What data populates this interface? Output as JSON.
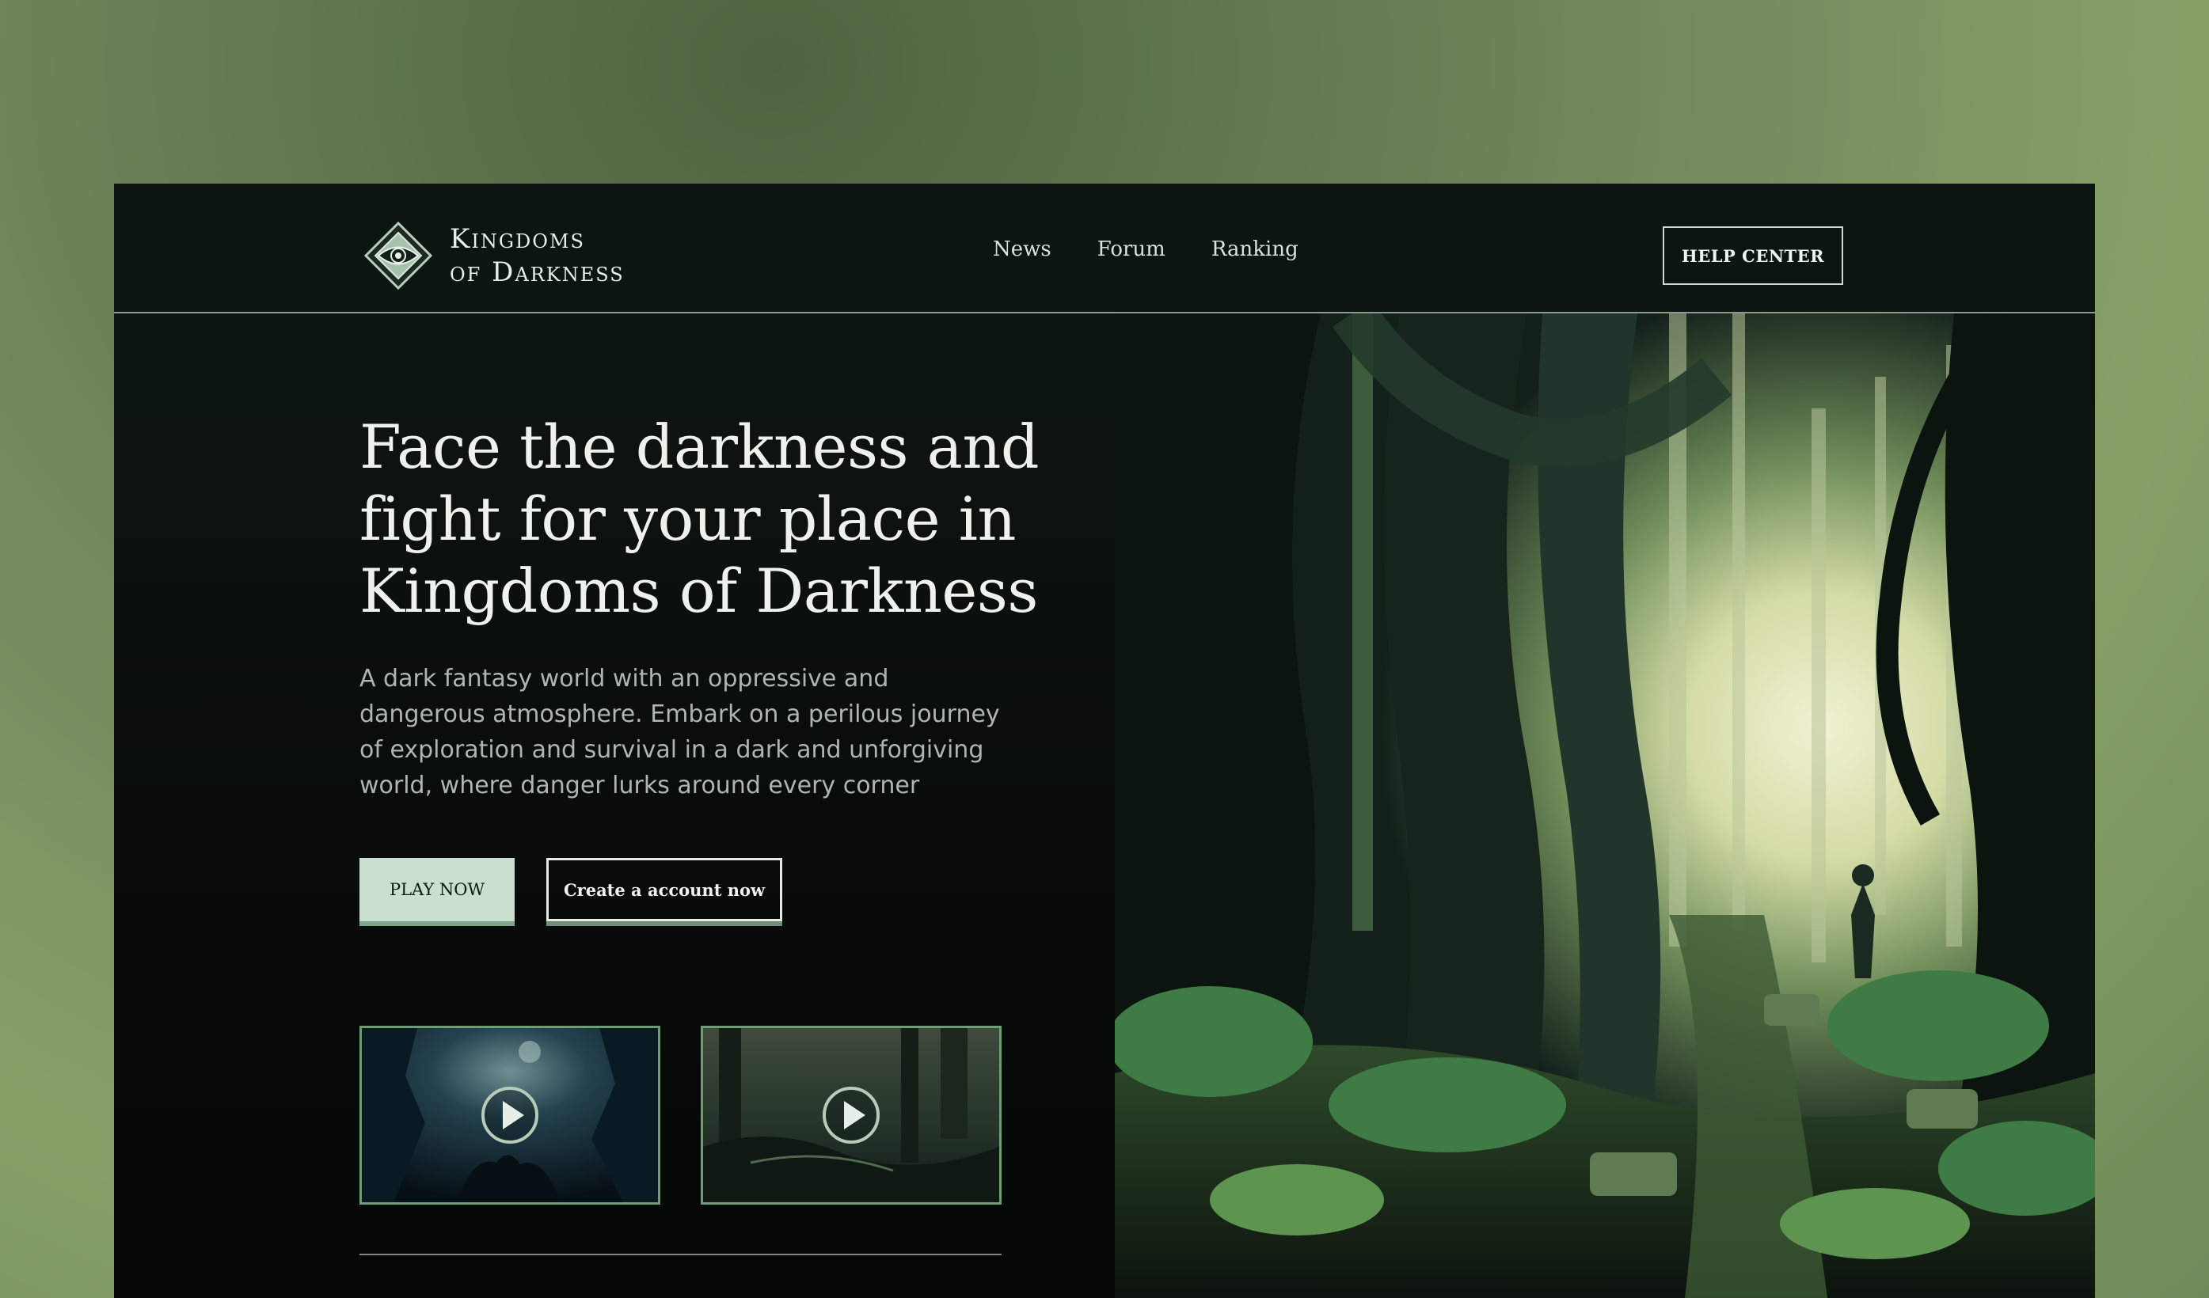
{
  "brand": {
    "name_line1": "Kingdoms",
    "name_line2": "of Darkness",
    "logo_icon": "eye-diamond-icon"
  },
  "nav": {
    "links": [
      {
        "label": "News"
      },
      {
        "label": "Forum"
      },
      {
        "label": "Ranking"
      }
    ],
    "help_label": "HELP CENTER"
  },
  "hero": {
    "title": "Face the darkness and fight for your place in Kingdoms of Darkness",
    "description": "A dark fantasy world with an oppressive and dangerous atmosphere. Embark on a perilous journey of exploration and survival in a dark and unforgiving world, where danger lurks around every corner",
    "play_label": "PLAY NOW",
    "create_label": "Create a account now"
  },
  "videos": [
    {
      "icon": "play-icon"
    },
    {
      "icon": "play-icon"
    }
  ],
  "colors": {
    "accent": "#c9dfcf",
    "frame_bg": "#050807",
    "thumb_border": "#6f9c77"
  }
}
